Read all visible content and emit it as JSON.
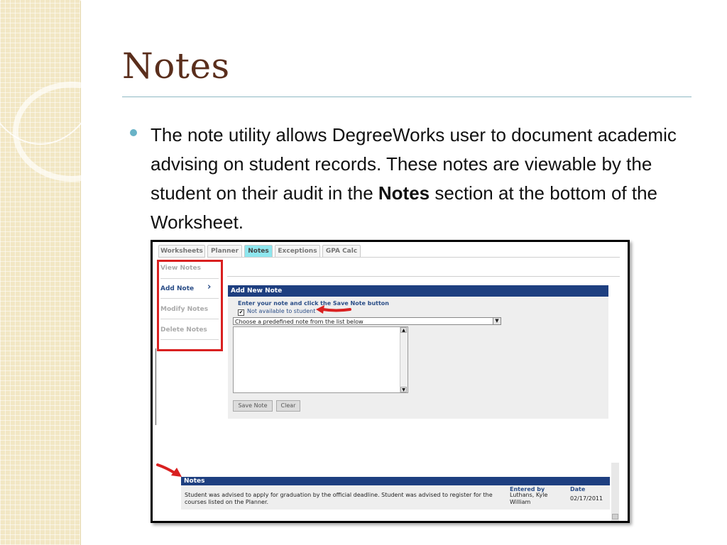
{
  "slide": {
    "title": "Notes",
    "bullet_prefix": "The note utility allows DegreeWorks user to document academic advising on student records. These notes are viewable by the student on their audit in the ",
    "bullet_bold": "Notes",
    "bullet_suffix": " section at the bottom of the Worksheet."
  },
  "screenshot": {
    "tabs": [
      {
        "label": "Worksheets"
      },
      {
        "label": "Planner"
      },
      {
        "label": "Notes"
      },
      {
        "label": "Exceptions"
      },
      {
        "label": "GPA Calc"
      }
    ],
    "sidebar": {
      "view": "View Notes",
      "add": "Add Note",
      "modify": "Modify Notes",
      "delete": "Delete Notes",
      "chevron": "›"
    },
    "add_note": {
      "header": "Add New Note",
      "instruction": "Enter your note and click the Save Note button",
      "checkbox_label": "Not available to student",
      "checkbox_mark": "✔",
      "select_value": "Choose a predefined note from the list below",
      "save_label": "Save Note",
      "clear_label": "Clear"
    },
    "notes_section": {
      "header": "Notes",
      "col_entered_by": "Entered by",
      "col_date": "Date",
      "note_text": "Student was advised to apply for graduation by the official deadline. Student was advised to register for the courses listed on the Planner.",
      "entered_by": "Luthans, Kyle William",
      "date": "02/17/2011"
    }
  },
  "colors": {
    "title": "#5a2e1c",
    "header_blue": "#1e3f80",
    "active_tab": "#8ee6ee",
    "highlight_red": "#d92020",
    "bullet": "#69b3c7"
  }
}
